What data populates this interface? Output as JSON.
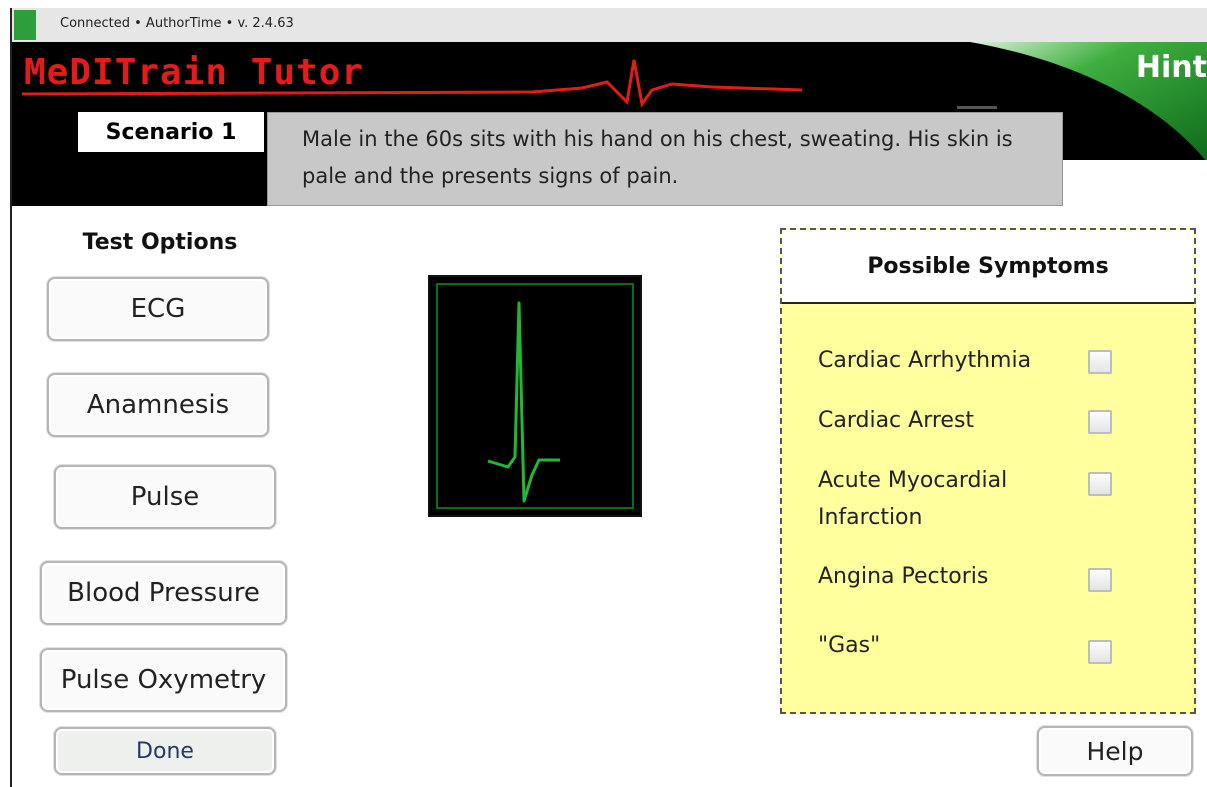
{
  "status_bar": {
    "text": "Connected  •  AuthorTime  •  v. 2.4.63"
  },
  "header": {
    "app_title": "MeDITrain Tutor",
    "hint_label": "Hint",
    "scenario_label": "Scenario 1",
    "scenario_text": "Male in the 60s sits with his hand on his chest, sweating. His skin is pale and the presents signs of pain."
  },
  "test_options": {
    "heading": "Test Options",
    "buttons": [
      "ECG",
      "Anamnesis",
      "Pulse",
      "Blood Pressure",
      "Pulse Oxymetry"
    ],
    "done_label": "Done"
  },
  "symptoms": {
    "heading": "Possible Symptoms",
    "items": [
      {
        "label": "Cardiac Arrhythmia",
        "checked": false
      },
      {
        "label": "Cardiac Arrest",
        "checked": false
      },
      {
        "label": "Acute Myocardial Infarction",
        "checked": false
      },
      {
        "label": "Angina Pectoris",
        "checked": false
      },
      {
        "label": "\"Gas\"",
        "checked": false
      }
    ]
  },
  "help_label": "Help",
  "colors": {
    "title_red": "#e51b1b",
    "hint_green": "#1e8a2e",
    "ecg_green": "#22b833",
    "symptom_panel": "#ffff9e",
    "scenario_box": "#c8c8c8"
  },
  "icons": {
    "status_indicator": "connection-led",
    "monitor_trace": "ecg-waveform"
  }
}
